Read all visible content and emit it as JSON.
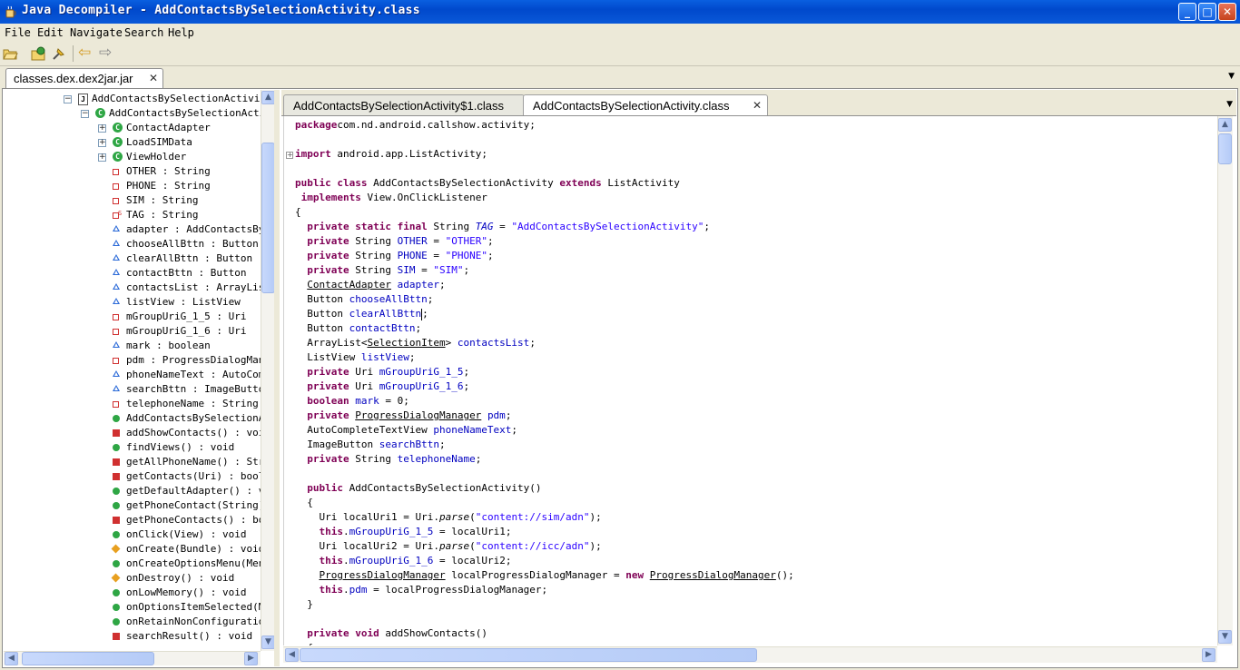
{
  "window": {
    "title": "Java Decompiler - AddContactsBySelectionActivity.class",
    "min": "_",
    "max": "□",
    "close": "✕"
  },
  "menu": [
    "File",
    "Edit",
    "Navigate",
    "Search",
    "Help"
  ],
  "toolbar": {
    "icons": [
      "open-file-icon",
      "open-type-icon",
      "pin-icon",
      "back-icon",
      "forward-icon"
    ],
    "back": "⇦",
    "forward": "⇨"
  },
  "jar_tab": {
    "label": "classes.dex.dex2jar.jar",
    "close": "✕"
  },
  "tree": {
    "rows": [
      {
        "text": "AddContactsBySelectionActivity",
        "kind": "file",
        "indent": 0
      },
      {
        "text": "AddContactsBySelectionActiv",
        "kind": "class",
        "indent": 1
      },
      {
        "text": "ContactAdapter",
        "kind": "class",
        "indent": 2
      },
      {
        "text": "LoadSIMData",
        "kind": "class",
        "indent": 2
      },
      {
        "text": "ViewHolder",
        "kind": "class",
        "indent": 2
      },
      {
        "text": "OTHER : String",
        "kind": "private-field",
        "indent": 2
      },
      {
        "text": "PHONE : String",
        "kind": "private-field",
        "indent": 2
      },
      {
        "text": "SIM : String",
        "kind": "private-field",
        "indent": 2
      },
      {
        "text": "TAG : String",
        "kind": "static-field",
        "indent": 2
      },
      {
        "text": "adapter : AddContactsBySel",
        "kind": "default-field",
        "indent": 2
      },
      {
        "text": "chooseAllBttn : Button",
        "kind": "default-field",
        "indent": 2
      },
      {
        "text": "clearAllBttn : Button",
        "kind": "default-field",
        "indent": 2
      },
      {
        "text": "contactBttn : Button",
        "kind": "default-field",
        "indent": 2
      },
      {
        "text": "contactsList : ArrayList",
        "kind": "default-field",
        "indent": 2
      },
      {
        "text": "listView : ListView",
        "kind": "default-field",
        "indent": 2
      },
      {
        "text": "mGroupUriG_1_5 : Uri",
        "kind": "private-field",
        "indent": 2
      },
      {
        "text": "mGroupUriG_1_6 : Uri",
        "kind": "private-field",
        "indent": 2
      },
      {
        "text": "mark : boolean",
        "kind": "default-field",
        "indent": 2
      },
      {
        "text": "pdm : ProgressDialogMana",
        "kind": "private-field",
        "indent": 2
      },
      {
        "text": "phoneNameText : AutoComp",
        "kind": "default-field",
        "indent": 2
      },
      {
        "text": "searchBttn : ImageButton",
        "kind": "default-field",
        "indent": 2
      },
      {
        "text": "telephoneName : String",
        "kind": "private-field",
        "indent": 2
      },
      {
        "text": "AddContactsBySelectionAc",
        "kind": "public-method",
        "indent": 2
      },
      {
        "text": "addShowContacts() : voi",
        "kind": "private-method",
        "indent": 2
      },
      {
        "text": "findViews() : void",
        "kind": "public-method",
        "indent": 2
      },
      {
        "text": "getAllPhoneName() : Stri",
        "kind": "private-method",
        "indent": 2
      },
      {
        "text": "getContacts(Uri) : boole",
        "kind": "private-method",
        "indent": 2
      },
      {
        "text": "getDefaultAdapter() : vo",
        "kind": "public-method",
        "indent": 2
      },
      {
        "text": "getPhoneContact(String)",
        "kind": "public-method",
        "indent": 2
      },
      {
        "text": "getPhoneContacts() : boo",
        "kind": "private-method",
        "indent": 2
      },
      {
        "text": "onClick(View) : void",
        "kind": "public-method",
        "indent": 2
      },
      {
        "text": "onCreate(Bundle) : void",
        "kind": "protected-method",
        "indent": 2
      },
      {
        "text": "onCreateOptionsMenu(Menu",
        "kind": "public-method",
        "indent": 2
      },
      {
        "text": "onDestroy() : void",
        "kind": "protected-method",
        "indent": 2
      },
      {
        "text": "onLowMemory() : void",
        "kind": "public-method",
        "indent": 2
      },
      {
        "text": "onOptionsItemSelected(Me",
        "kind": "public-method",
        "indent": 2
      },
      {
        "text": "onRetainNonConfiguration",
        "kind": "public-method",
        "indent": 2
      },
      {
        "text": "searchResult() : void",
        "kind": "private-method",
        "indent": 2
      }
    ]
  },
  "editor_tabs": [
    {
      "label": "AddContactsBySelectionActivity$1.class",
      "active": false
    },
    {
      "label": "AddContactsBySelectionActivity.class",
      "active": true,
      "close": "✕"
    }
  ],
  "colors": {
    "keyword": "#7F0055",
    "string": "#2A00FF",
    "field": "#0000C0",
    "titlebar": "#0A5FE0",
    "class-icon": "#2EA644",
    "private-icon": "#D03030",
    "default-icon": "#2C6BD8",
    "protected-icon": "#E8A020"
  },
  "code_lines": [
    [
      [
        "kw",
        "package"
      ],
      [
        "",
        "com.nd.android.callshow.activity;"
      ]
    ],
    [],
    [
      [
        "kw",
        "import"
      ],
      [
        "",
        " android.app.ListActivity;"
      ]
    ],
    [],
    [
      [
        "kw",
        "public class"
      ],
      [
        "",
        " AddContactsBySelectionActivity "
      ],
      [
        "kw",
        "extends"
      ],
      [
        "",
        " ListActivity"
      ]
    ],
    [
      [
        "",
        " "
      ],
      [
        "kw",
        "implements"
      ],
      [
        "",
        " View.OnClickListener"
      ]
    ],
    [
      [
        "",
        "{"
      ]
    ],
    [
      [
        "",
        "  "
      ],
      [
        "kw",
        "private static final"
      ],
      [
        "",
        " String "
      ],
      [
        "it fld",
        "TAG"
      ],
      [
        "",
        " = "
      ],
      [
        "str",
        "\"AddContactsBySelectionActivity\""
      ],
      [
        "",
        ";"
      ]
    ],
    [
      [
        "",
        "  "
      ],
      [
        "kw",
        "private"
      ],
      [
        "",
        " String "
      ],
      [
        "fld",
        "OTHER"
      ],
      [
        "",
        " = "
      ],
      [
        "str",
        "\"OTHER\""
      ],
      [
        "",
        ";"
      ]
    ],
    [
      [
        "",
        "  "
      ],
      [
        "kw",
        "private"
      ],
      [
        "",
        " String "
      ],
      [
        "fld",
        "PHONE"
      ],
      [
        "",
        " = "
      ],
      [
        "str",
        "\"PHONE\""
      ],
      [
        "",
        ";"
      ]
    ],
    [
      [
        "",
        "  "
      ],
      [
        "kw",
        "private"
      ],
      [
        "",
        " String "
      ],
      [
        "fld",
        "SIM"
      ],
      [
        "",
        " = "
      ],
      [
        "str",
        "\"SIM\""
      ],
      [
        "",
        ";"
      ]
    ],
    [
      [
        "",
        "  "
      ],
      [
        "ul",
        "ContactAdapter"
      ],
      [
        "",
        " "
      ],
      [
        "fld",
        "adapter"
      ],
      [
        "",
        ";"
      ]
    ],
    [
      [
        "",
        "  Button "
      ],
      [
        "fld",
        "chooseAllBttn"
      ],
      [
        "",
        ";"
      ]
    ],
    [
      [
        "",
        "  Button "
      ],
      [
        "fld",
        "clearAllBttn"
      ],
      [
        "caret",
        ""
      ],
      [
        "",
        ";"
      ]
    ],
    [
      [
        "",
        "  Button "
      ],
      [
        "fld",
        "contactBttn"
      ],
      [
        "",
        ";"
      ]
    ],
    [
      [
        "",
        "  ArrayList<"
      ],
      [
        "ul",
        "SelectionItem"
      ],
      [
        "",
        "> "
      ],
      [
        "fld",
        "contactsList"
      ],
      [
        "",
        ";"
      ]
    ],
    [
      [
        "",
        "  ListView "
      ],
      [
        "fld",
        "listView"
      ],
      [
        "",
        ";"
      ]
    ],
    [
      [
        "",
        "  "
      ],
      [
        "kw",
        "private"
      ],
      [
        "",
        " Uri "
      ],
      [
        "fld",
        "mGroupUriG_1_5"
      ],
      [
        "",
        ";"
      ]
    ],
    [
      [
        "",
        "  "
      ],
      [
        "kw",
        "private"
      ],
      [
        "",
        " Uri "
      ],
      [
        "fld",
        "mGroupUriG_1_6"
      ],
      [
        "",
        ";"
      ]
    ],
    [
      [
        "",
        "  "
      ],
      [
        "kw",
        "boolean"
      ],
      [
        "",
        " "
      ],
      [
        "fld",
        "mark"
      ],
      [
        "",
        " = 0;"
      ]
    ],
    [
      [
        "",
        "  "
      ],
      [
        "kw",
        "private"
      ],
      [
        "",
        " "
      ],
      [
        "ul",
        "ProgressDialogManager"
      ],
      [
        "",
        " "
      ],
      [
        "fld",
        "pdm"
      ],
      [
        "",
        ";"
      ]
    ],
    [
      [
        "",
        "  AutoCompleteTextView "
      ],
      [
        "fld",
        "phoneNameText"
      ],
      [
        "",
        ";"
      ]
    ],
    [
      [
        "",
        "  ImageButton "
      ],
      [
        "fld",
        "searchBttn"
      ],
      [
        "",
        ";"
      ]
    ],
    [
      [
        "",
        "  "
      ],
      [
        "kw",
        "private"
      ],
      [
        "",
        " String "
      ],
      [
        "fld",
        "telephoneName"
      ],
      [
        "",
        ";"
      ]
    ],
    [],
    [
      [
        "",
        "  "
      ],
      [
        "kw",
        "public"
      ],
      [
        "",
        " AddContactsBySelectionActivity()"
      ]
    ],
    [
      [
        "",
        "  {"
      ]
    ],
    [
      [
        "",
        "    Uri localUri1 = Uri."
      ],
      [
        "it",
        "parse"
      ],
      [
        "",
        "("
      ],
      [
        "str",
        "\"content://sim/adn\""
      ],
      [
        "",
        ");"
      ]
    ],
    [
      [
        "",
        "    "
      ],
      [
        "kw",
        "this"
      ],
      [
        "",
        "."
      ],
      [
        "fld",
        "mGroupUriG_1_5"
      ],
      [
        "",
        " = localUri1;"
      ]
    ],
    [
      [
        "",
        "    Uri localUri2 = Uri."
      ],
      [
        "it",
        "parse"
      ],
      [
        "",
        "("
      ],
      [
        "str",
        "\"content://icc/adn\""
      ],
      [
        "",
        ");"
      ]
    ],
    [
      [
        "",
        "    "
      ],
      [
        "kw",
        "this"
      ],
      [
        "",
        "."
      ],
      [
        "fld",
        "mGroupUriG_1_6"
      ],
      [
        "",
        " = localUri2;"
      ]
    ],
    [
      [
        "",
        "    "
      ],
      [
        "ul",
        "ProgressDialogManager"
      ],
      [
        "",
        " localProgressDialogManager = "
      ],
      [
        "kw",
        "new"
      ],
      [
        "",
        " "
      ],
      [
        "ul",
        "ProgressDialogManager"
      ],
      [
        "",
        "();"
      ]
    ],
    [
      [
        "",
        "    "
      ],
      [
        "kw",
        "this"
      ],
      [
        "",
        "."
      ],
      [
        "fld",
        "pdm"
      ],
      [
        "",
        " = localProgressDialogManager;"
      ]
    ],
    [
      [
        "",
        "  }"
      ]
    ],
    [],
    [
      [
        "",
        "  "
      ],
      [
        "kw",
        "private void"
      ],
      [
        "",
        " addShowContacts()"
      ]
    ],
    [
      [
        "",
        "  {"
      ]
    ]
  ]
}
